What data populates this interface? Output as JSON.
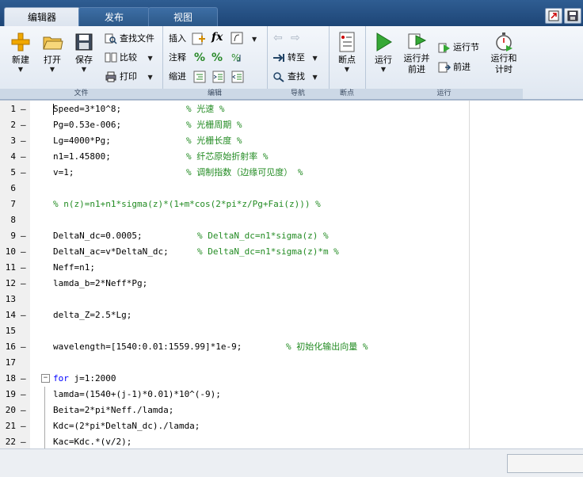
{
  "tabs": [
    "编辑器",
    "发布",
    "视图"
  ],
  "colors": {
    "tab_bar": "#1d4576",
    "comment": "#228b22",
    "keyword": "#0000ff"
  },
  "ribbon": {
    "file": {
      "group_label": "文件",
      "new_label": "新建",
      "open_label": "打开",
      "save_label": "保存",
      "find_files_label": "查找文件",
      "compare_label": "比较",
      "print_label": "打印"
    },
    "edit": {
      "group_label": "编辑",
      "insert_label": "插入",
      "comment_label": "注释",
      "indent_label": "缩进"
    },
    "navigate": {
      "group_label": "导航",
      "goto_label": "转至",
      "find_label": "查找"
    },
    "breakpoints": {
      "group_label": "断点",
      "breakpoints_label": "断点"
    },
    "run": {
      "group_label": "运行",
      "run_label": "运行",
      "run_advance_label": "运行并\n前进",
      "run_section_label": "运行节",
      "advance_label": "前进",
      "run_time_label": "运行和\n计时"
    }
  },
  "code_lines": [
    {
      "n": "1",
      "dash": "–",
      "code": "Speed=3*10^8;",
      "comment": "% 光速 %",
      "ccol": 235
    },
    {
      "n": "2",
      "dash": "–",
      "code": "Pg=0.53e-006;",
      "comment": "% 光栅周期 %",
      "ccol": 235
    },
    {
      "n": "3",
      "dash": "–",
      "code": "Lg=4000*Pg;",
      "comment": "% 光栅长度 %",
      "ccol": 235
    },
    {
      "n": "4",
      "dash": "–",
      "code": "n1=1.45800;",
      "comment": "% 纤芯原始折射率 %",
      "ccol": 235
    },
    {
      "n": "5",
      "dash": "–",
      "code": "v=1;",
      "comment": "% 调制指数（边缘可见度） %",
      "ccol": 235
    },
    {
      "n": "6",
      "dash": "",
      "code": "",
      "comment": "",
      "ccol": 0
    },
    {
      "n": "7",
      "dash": "",
      "code": "",
      "comment": "% n(z)=n1+n1*sigma(z)*(1+m*cos(2*pi*z/Pg+Fai(z))) %",
      "ccol": 67
    },
    {
      "n": "8",
      "dash": "",
      "code": "",
      "comment": "",
      "ccol": 0
    },
    {
      "n": "9",
      "dash": "–",
      "code": "DeltaN_dc=0.0005;",
      "comment": "% DeltaN_dc=n1*sigma(z) %",
      "ccol": 249
    },
    {
      "n": "10",
      "dash": "–",
      "code": "DeltaN_ac=v*DeltaN_dc;",
      "comment": "% DeltaN_dc=n1*sigma(z)*m %",
      "ccol": 249
    },
    {
      "n": "11",
      "dash": "–",
      "code": "Neff=n1;",
      "comment": "",
      "ccol": 0
    },
    {
      "n": "12",
      "dash": "–",
      "code": "lamda_b=2*Neff*Pg;",
      "comment": "",
      "ccol": 0
    },
    {
      "n": "13",
      "dash": "",
      "code": "",
      "comment": "",
      "ccol": 0
    },
    {
      "n": "14",
      "dash": "–",
      "code": "delta_Z=2.5*Lg;",
      "comment": "",
      "ccol": 0
    },
    {
      "n": "15",
      "dash": "",
      "code": "",
      "comment": "",
      "ccol": 0
    },
    {
      "n": "16",
      "dash": "–",
      "code": "wavelength=[1540:0.01:1559.99]*1e-9;",
      "comment": "% 初始化输出向量 %",
      "ccol": 361
    },
    {
      "n": "17",
      "dash": "",
      "code": "",
      "comment": "",
      "ccol": 0
    },
    {
      "n": "18",
      "dash": "–",
      "code": "for j=1:2000",
      "comment": "",
      "ccol": 0,
      "fold": true
    },
    {
      "n": "19",
      "dash": "–",
      "code": "lamda=(1540+(j-1)*0.01)*10^(-9);",
      "comment": "",
      "ccol": 0
    },
    {
      "n": "20",
      "dash": "–",
      "code": "Beita=2*pi*Neff./lamda;",
      "comment": "",
      "ccol": 0
    },
    {
      "n": "21",
      "dash": "–",
      "code": "Kdc=(2*pi*DeltaN_dc)./lamda;",
      "comment": "",
      "ccol": 0
    },
    {
      "n": "22",
      "dash": "–",
      "code": "Kac=Kdc.*(v/2);",
      "comment": "",
      "ccol": 0
    }
  ]
}
